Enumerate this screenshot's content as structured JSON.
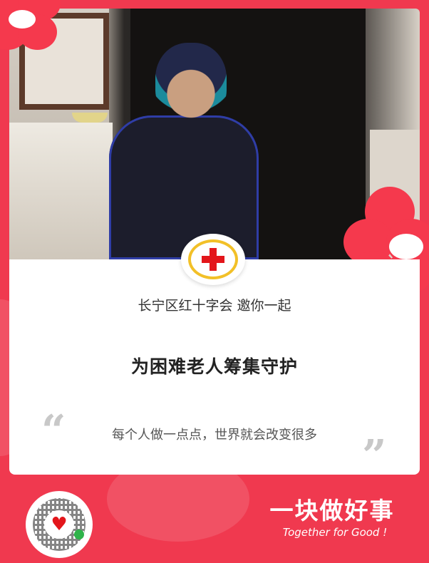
{
  "poster": {
    "invite_text": "长宁区红十字会 邀你一起",
    "headline": "为困难老人筹集守护",
    "quote_open": "“",
    "slogan": "每个人做一点点，世界就会改变很多",
    "quote_close": "”",
    "brand_cn": "一块做好事",
    "brand_en": "Together for Good !"
  },
  "icons": {
    "emblem": "red-cross-emblem-icon",
    "qr": "qr-code-icon",
    "heart": "heart-icon",
    "wechat": "wechat-icon"
  },
  "colors": {
    "background": "#f0394f",
    "card": "#ffffff",
    "cross": "#e3161b",
    "wreath": "#f2c028"
  }
}
